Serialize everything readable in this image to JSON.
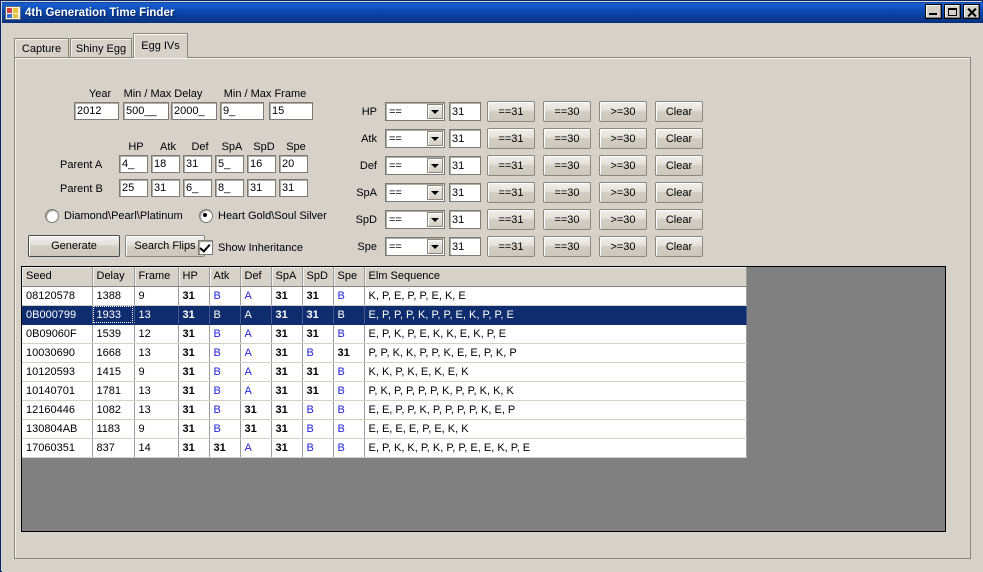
{
  "window": {
    "title": "4th Generation Time Finder",
    "icon": "app-icon",
    "buttons": {
      "minimize": "minimize",
      "maximize": "maximize",
      "close": "close"
    }
  },
  "tabs": [
    {
      "label": "Capture",
      "active": false
    },
    {
      "label": "Shiny Egg",
      "active": false
    },
    {
      "label": "Egg IVs",
      "active": true
    }
  ],
  "form": {
    "labels": {
      "year": "Year",
      "delay": "Min / Max Delay",
      "frame": "Min / Max Frame",
      "parent_a": "Parent A",
      "parent_b": "Parent B"
    },
    "stat_headers": [
      "HP",
      "Atk",
      "Def",
      "SpA",
      "SpD",
      "Spe"
    ],
    "year": "2012",
    "min_delay": "500__",
    "max_delay": "2000_",
    "min_frame": "9_",
    "max_frame": "15",
    "parent_a": [
      "4_",
      "18",
      "31",
      "5_",
      "16",
      "20"
    ],
    "parent_b": [
      "25",
      "31",
      "6_",
      "8_",
      "31",
      "31"
    ],
    "game_options": [
      {
        "label": "Diamond\\Pearl\\Platinum",
        "selected": false
      },
      {
        "label": "Heart Gold\\Soul Silver",
        "selected": true
      }
    ],
    "generate_label": "Generate",
    "search_flips_label": "Search Flips",
    "show_inheritance": {
      "label": "Show Inheritance",
      "checked": true
    }
  },
  "filters": {
    "operator": "==",
    "value": "31",
    "btn_eq31": "==31",
    "btn_eq30": "==30",
    "btn_ge30": ">=30",
    "btn_clear": "Clear",
    "rows": [
      {
        "stat": "HP"
      },
      {
        "stat": "Atk"
      },
      {
        "stat": "Def"
      },
      {
        "stat": "SpA"
      },
      {
        "stat": "SpD"
      },
      {
        "stat": "Spe"
      }
    ]
  },
  "grid": {
    "columns": [
      "Seed",
      "Delay",
      "Frame",
      "HP",
      "Atk",
      "Def",
      "SpA",
      "SpD",
      "Spe",
      "Elm Sequence"
    ],
    "rows": [
      {
        "seed": "08120578",
        "delay": "1388",
        "frame": "9",
        "ivs": [
          "31",
          "B",
          "A",
          "31",
          "31",
          "B"
        ],
        "elm": "K, P, E, P, P, E, K, E",
        "selected": false
      },
      {
        "seed": "0B000799",
        "delay": "1933",
        "frame": "13",
        "ivs": [
          "31",
          "B",
          "A",
          "31",
          "31",
          "B"
        ],
        "elm": "E, P, P, P, K, P, P, E, K, P, P, E",
        "selected": true
      },
      {
        "seed": "0B09060F",
        "delay": "1539",
        "frame": "12",
        "ivs": [
          "31",
          "B",
          "A",
          "31",
          "31",
          "B"
        ],
        "elm": "E, P, K, P, E, K, K, E, K, P, E",
        "selected": false
      },
      {
        "seed": "10030690",
        "delay": "1668",
        "frame": "13",
        "ivs": [
          "31",
          "B",
          "A",
          "31",
          "B",
          "31"
        ],
        "elm": "P, P, K, K, P, P, K, E, E, P, K, P",
        "selected": false
      },
      {
        "seed": "10120593",
        "delay": "1415",
        "frame": "9",
        "ivs": [
          "31",
          "B",
          "A",
          "31",
          "31",
          "B"
        ],
        "elm": "K, K, P, K, E, K, E, K",
        "selected": false
      },
      {
        "seed": "10140701",
        "delay": "1781",
        "frame": "13",
        "ivs": [
          "31",
          "B",
          "A",
          "31",
          "31",
          "B"
        ],
        "elm": "P, K, P, P, P, P, K, P, P, K, K, K",
        "selected": false
      },
      {
        "seed": "12160446",
        "delay": "1082",
        "frame": "13",
        "ivs": [
          "31",
          "B",
          "31",
          "31",
          "B",
          "B"
        ],
        "elm": "E, E, P, P, K, P, P, P, P, K, E, P",
        "selected": false
      },
      {
        "seed": "130804AB",
        "delay": "1183",
        "frame": "9",
        "ivs": [
          "31",
          "B",
          "31",
          "31",
          "B",
          "B"
        ],
        "elm": "E, E, E, E, P, E, K, K",
        "selected": false
      },
      {
        "seed": "17060351",
        "delay": "837",
        "frame": "14",
        "ivs": [
          "31",
          "31",
          "A",
          "31",
          "B",
          "B"
        ],
        "elm": "E, P, K, K, P, K, P, P, E, E, K, P, E",
        "selected": false
      }
    ]
  },
  "colors": {
    "titlebar": "#0b4bb5",
    "face": "#d6d2c9",
    "selection": "#0f2c6e",
    "inherit_letter": "#2222dd",
    "grid_empty": "#808080"
  }
}
